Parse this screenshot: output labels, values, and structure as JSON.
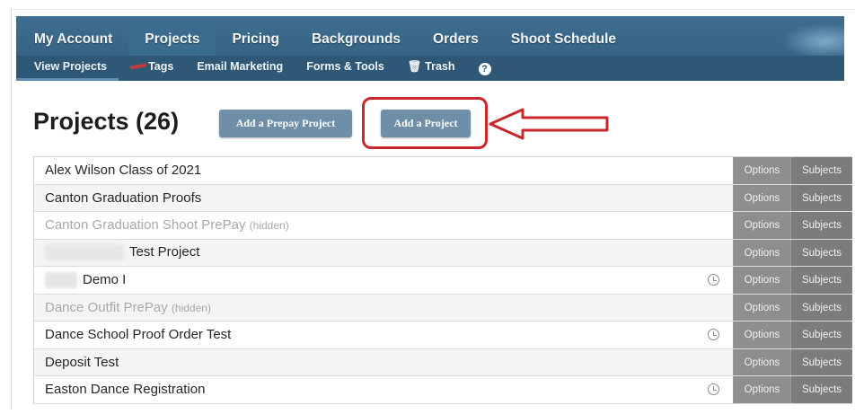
{
  "nav": {
    "top": [
      {
        "label": "My Account",
        "active": false
      },
      {
        "label": "Projects",
        "active": true
      },
      {
        "label": "Pricing",
        "active": false
      },
      {
        "label": "Backgrounds",
        "active": false
      },
      {
        "label": "Orders",
        "active": false
      },
      {
        "label": "Shoot Schedule",
        "active": false
      }
    ],
    "sub": {
      "view_projects": "View Projects",
      "tags": "Tags",
      "email_marketing": "Email Marketing",
      "forms_tools": "Forms & Tools",
      "trash_icon": "🗑",
      "trash": "Trash",
      "help_icon": "?"
    }
  },
  "header": {
    "title": "Projects (26)",
    "add_prepay_label": "Add a Prepay Project",
    "add_project_label": "Add a Project"
  },
  "table": {
    "options_label": "Options",
    "subjects_label": "Subjects",
    "hidden_label": "(hidden)",
    "rows": [
      {
        "name": "Alex Wilson Class of 2021",
        "hidden": false,
        "clock": false
      },
      {
        "name": "Canton Graduation Proofs",
        "hidden": false,
        "clock": false
      },
      {
        "name": "Canton Graduation Shoot PrePay",
        "hidden": true,
        "clock": false
      },
      {
        "name": "Test Project",
        "hidden": false,
        "clock": false,
        "redacted_prefix": true
      },
      {
        "name": "Demo I",
        "hidden": false,
        "clock": true,
        "redacted_prefix": true
      },
      {
        "name": "Dance Outfit PrePay",
        "hidden": true,
        "clock": false
      },
      {
        "name": "Dance School Proof Order Test",
        "hidden": false,
        "clock": true
      },
      {
        "name": "Deposit Test",
        "hidden": false,
        "clock": false
      },
      {
        "name": "Easton Dance Registration",
        "hidden": false,
        "clock": true
      }
    ]
  },
  "colors": {
    "nav_bg": "#3f6e90",
    "subnav_bg": "#2f5877",
    "button_bg": "#6f8fa8",
    "highlight": "#c9272b",
    "options_bg": "#8e8e8e",
    "subjects_bg": "#7c7c7c"
  }
}
